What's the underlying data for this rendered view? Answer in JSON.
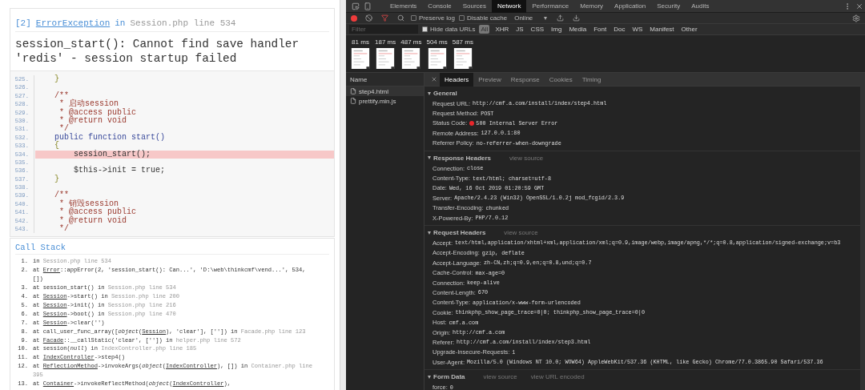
{
  "error_page": {
    "exception": {
      "index": "[2]",
      "class": "ErrorException",
      "in": "in",
      "location": "Session.php line 534"
    },
    "message": "session_start(): Cannot find save handler 'redis' - session startup failed",
    "code_lines": [
      {
        "number": "525.",
        "text": "    }",
        "kind": "brace",
        "highlighted": false
      },
      {
        "number": "526.",
        "kind": "code",
        "highlighted": false
      },
      {
        "number": "527.",
        "text": "    /**",
        "kind": "comment",
        "highlighted": false
      },
      {
        "number": "528.",
        "text": "     * 启动session",
        "kind": "comment",
        "highlighted": false
      },
      {
        "number": "529.",
        "text": "     * @access public",
        "kind": "comment",
        "highlighted": false
      },
      {
        "number": "530.",
        "text": "     * @return void",
        "kind": "comment",
        "highlighted": false
      },
      {
        "number": "531.",
        "text": "     */",
        "kind": "comment",
        "highlighted": false
      },
      {
        "number": "532.",
        "text": "    public function start()",
        "kind": "keyword",
        "highlighted": false
      },
      {
        "number": "533.",
        "text": "    {",
        "kind": "brace",
        "highlighted": false
      },
      {
        "number": "534.",
        "text": "        session_start();",
        "kind": "code",
        "highlighted": true
      },
      {
        "number": "535.",
        "kind": "code",
        "highlighted": false
      },
      {
        "number": "536.",
        "text": "        $this->init = true;",
        "kind": "code",
        "highlighted": false
      },
      {
        "number": "537.",
        "text": "    }",
        "kind": "brace",
        "highlighted": false
      },
      {
        "number": "538.",
        "kind": "code",
        "highlighted": false
      },
      {
        "number": "539.",
        "text": "    /**",
        "kind": "comment",
        "highlighted": false
      },
      {
        "number": "540.",
        "text": "     * 销毁session",
        "kind": "comment",
        "highlighted": false
      },
      {
        "number": "541.",
        "text": "     * @access public",
        "kind": "comment",
        "highlighted": false
      },
      {
        "number": "542.",
        "text": "     * @return void",
        "kind": "comment",
        "highlighted": false
      },
      {
        "number": "543.",
        "text": "     */",
        "kind": "comment",
        "highlighted": false
      }
    ],
    "call_stack": {
      "title": "Call Stack",
      "items": [
        {
          "number": "1.",
          "parts": [
            {
              "text": "in ",
              "kind": "code"
            },
            {
              "text": "Session.php line 534",
              "kind": "file"
            }
          ]
        },
        {
          "number": "2.",
          "parts": [
            {
              "text": "at ",
              "kind": "code"
            },
            {
              "text": "Error",
              "kind": "link"
            },
            {
              "text": "::appError(2, 'session_start(): Can...', 'D:\\web\\thinkcmf\\vend...', 534, [])",
              "kind": "code"
            }
          ]
        },
        {
          "number": "3.",
          "parts": [
            {
              "text": "at session_start() in ",
              "kind": "code"
            },
            {
              "text": "Session.php line 534",
              "kind": "file"
            }
          ]
        },
        {
          "number": "4.",
          "parts": [
            {
              "text": "at ",
              "kind": "code"
            },
            {
              "text": "Session",
              "kind": "link"
            },
            {
              "text": "->start() in ",
              "kind": "code"
            },
            {
              "text": "Session.php line 200",
              "kind": "file"
            }
          ]
        },
        {
          "number": "5.",
          "parts": [
            {
              "text": "at ",
              "kind": "code"
            },
            {
              "text": "Session",
              "kind": "link"
            },
            {
              "text": "->init() in ",
              "kind": "code"
            },
            {
              "text": "Session.php line 216",
              "kind": "file"
            }
          ]
        },
        {
          "number": "6.",
          "parts": [
            {
              "text": "at ",
              "kind": "code"
            },
            {
              "text": "Session",
              "kind": "link"
            },
            {
              "text": "->boot() in ",
              "kind": "code"
            },
            {
              "text": "Session.php line 470",
              "kind": "file"
            }
          ]
        },
        {
          "number": "7.",
          "parts": [
            {
              "text": "at ",
              "kind": "code"
            },
            {
              "text": "Session",
              "kind": "link"
            },
            {
              "text": "->clear('')",
              "kind": "code"
            }
          ]
        },
        {
          "number": "8.",
          "parts": [
            {
              "text": "at call_user_func_array([",
              "kind": "code"
            },
            {
              "text": "object",
              "kind": "italic"
            },
            {
              "text": "(",
              "kind": "code"
            },
            {
              "text": "Session",
              "kind": "link"
            },
            {
              "text": "), 'clear'], ['']) in ",
              "kind": "code"
            },
            {
              "text": "Facade.php line 123",
              "kind": "file"
            }
          ]
        },
        {
          "number": "9.",
          "parts": [
            {
              "text": "at ",
              "kind": "code"
            },
            {
              "text": "Facade",
              "kind": "link"
            },
            {
              "text": "::__callStatic('clear', ['']) in ",
              "kind": "code"
            },
            {
              "text": "helper.php line 572",
              "kind": "file"
            }
          ]
        },
        {
          "number": "10.",
          "parts": [
            {
              "text": "at session(",
              "kind": "code"
            },
            {
              "text": "null",
              "kind": "italic"
            },
            {
              "text": ") in ",
              "kind": "code"
            },
            {
              "text": "IndexController.php line 185",
              "kind": "file"
            }
          ]
        },
        {
          "number": "11.",
          "parts": [
            {
              "text": "at ",
              "kind": "code"
            },
            {
              "text": "IndexController",
              "kind": "link"
            },
            {
              "text": "->step4()",
              "kind": "code"
            }
          ]
        },
        {
          "number": "12.",
          "parts": [
            {
              "text": "at ",
              "kind": "code"
            },
            {
              "text": "ReflectionMethod",
              "kind": "link"
            },
            {
              "text": "->invokeArgs(",
              "kind": "code"
            },
            {
              "text": "object",
              "kind": "italic"
            },
            {
              "text": "(",
              "kind": "code"
            },
            {
              "text": "IndexController",
              "kind": "link"
            },
            {
              "text": "), []) in ",
              "kind": "code"
            },
            {
              "text": "Container.php line 395",
              "kind": "file"
            }
          ]
        },
        {
          "number": "13.",
          "parts": [
            {
              "text": "at ",
              "kind": "code"
            },
            {
              "text": "Container",
              "kind": "link"
            },
            {
              "text": "->invokeReflectMethod(",
              "kind": "code"
            },
            {
              "text": "object",
              "kind": "italic"
            },
            {
              "text": "(",
              "kind": "code"
            },
            {
              "text": "IndexController",
              "kind": "link"
            },
            {
              "text": "),",
              "kind": "code"
            }
          ]
        }
      ]
    }
  },
  "devtools": {
    "tabs": [
      {
        "label": "Elements",
        "selected": false
      },
      {
        "label": "Console",
        "selected": false
      },
      {
        "label": "Sources",
        "selected": false
      },
      {
        "label": "Network",
        "selected": true
      },
      {
        "label": "Performance",
        "selected": false
      },
      {
        "label": "Memory",
        "selected": false
      },
      {
        "label": "Application",
        "selected": false
      },
      {
        "label": "Security",
        "selected": false
      },
      {
        "label": "Audits",
        "selected": false
      }
    ],
    "toolbar": {
      "recording": true,
      "filter_active": true,
      "preserve_log": {
        "label": "Preserve log",
        "checked": false
      },
      "disable_cache": {
        "label": "Disable cache",
        "checked": false
      },
      "throttling": "Online"
    },
    "filter": {
      "placeholder": "Filter",
      "hide_data_urls": {
        "label": "Hide data URLs",
        "checked": true
      },
      "types": [
        {
          "label": "All",
          "selected": true
        },
        {
          "label": "XHR",
          "selected": false
        },
        {
          "label": "JS",
          "selected": false
        },
        {
          "label": "CSS",
          "selected": false
        },
        {
          "label": "Img",
          "selected": false
        },
        {
          "label": "Media",
          "selected": false
        },
        {
          "label": "Font",
          "selected": false
        },
        {
          "label": "Doc",
          "selected": false
        },
        {
          "label": "WS",
          "selected": false
        },
        {
          "label": "Manifest",
          "selected": false
        },
        {
          "label": "Other",
          "selected": false
        }
      ]
    },
    "frames": [
      {
        "time": "81 ms"
      },
      {
        "time": "187 ms"
      },
      {
        "time": "487 ms"
      },
      {
        "time": "504 ms"
      },
      {
        "time": "587 ms"
      }
    ],
    "requests": {
      "header": "Name",
      "items": [
        {
          "name": "step4.html",
          "selected": true
        },
        {
          "name": "prettify.min.js",
          "selected": false
        }
      ]
    },
    "detail_tabs": [
      {
        "label": "Headers",
        "selected": true
      },
      {
        "label": "Preview",
        "selected": false
      },
      {
        "label": "Response",
        "selected": false
      },
      {
        "label": "Cookies",
        "selected": false
      },
      {
        "label": "Timing",
        "selected": false
      }
    ],
    "sections": [
      {
        "title": "General",
        "expanded": true,
        "rows": [
          {
            "key": "Request URL:",
            "value": "http://cmf.a.com/install/index/step4.html"
          },
          {
            "key": "Request Method:",
            "value": "POST"
          },
          {
            "key": "Status Code:",
            "value": "500 Internal Server Error",
            "kind": "status",
            "color": "#e8262b"
          },
          {
            "key": "Remote Address:",
            "value": "127.0.0.1:80"
          },
          {
            "key": "Referrer Policy:",
            "value": "no-referrer-when-downgrade"
          }
        ]
      },
      {
        "title": "Response Headers",
        "expanded": true,
        "links": [
          "view source"
        ],
        "rows": [
          {
            "key": "Connection:",
            "value": "close"
          },
          {
            "key": "Content-Type:",
            "value": "text/html; charset=utf-8"
          },
          {
            "key": "Date:",
            "value": "Wed, 16 Oct 2019 01:20:59 GMT"
          },
          {
            "key": "Server:",
            "value": "Apache/2.4.23 (Win32) OpenSSL/1.0.2j mod_fcgid/2.3.9"
          },
          {
            "key": "Transfer-Encoding:",
            "value": "chunked"
          },
          {
            "key": "X-Powered-By:",
            "value": "PHP/7.0.12"
          }
        ]
      },
      {
        "title": "Request Headers",
        "expanded": true,
        "links": [
          "view source"
        ],
        "rows": [
          {
            "key": "Accept:",
            "value": "text/html,application/xhtml+xml,application/xml;q=0.9,image/webp,image/apng,*/*;q=0.8,application/signed-exchange;v=b3"
          },
          {
            "key": "Accept-Encoding:",
            "value": "gzip, deflate"
          },
          {
            "key": "Accept-Language:",
            "value": "zh-CN,zh;q=0.9,en;q=0.8,und;q=0.7"
          },
          {
            "key": "Cache-Control:",
            "value": "max-age=0"
          },
          {
            "key": "Connection:",
            "value": "keep-alive"
          },
          {
            "key": "Content-Length:",
            "value": "670"
          },
          {
            "key": "Content-Type:",
            "value": "application/x-www-form-urlencoded"
          },
          {
            "key": "Cookie:",
            "value": "thinkphp_show_page_trace=0|0; thinkphp_show_page_trace=0|0"
          },
          {
            "key": "Host:",
            "value": "cmf.a.com"
          },
          {
            "key": "Origin:",
            "value": "http://cmf.a.com"
          },
          {
            "key": "Referer:",
            "value": "http://cmf.a.com/install/index/step3.html"
          },
          {
            "key": "Upgrade-Insecure-Requests:",
            "value": "1"
          },
          {
            "key": "User-Agent:",
            "value": "Mozilla/5.0 (Windows NT 10.0; WOW64) AppleWebKit/537.36 (KHTML, like Gecko) Chrome/77.0.3865.90 Safari/537.36"
          }
        ]
      },
      {
        "title": "Form Data",
        "expanded": true,
        "links": [
          "view source",
          "view URL encoded"
        ],
        "rows": [
          {
            "key": "force:",
            "value": "0"
          }
        ]
      }
    ]
  }
}
